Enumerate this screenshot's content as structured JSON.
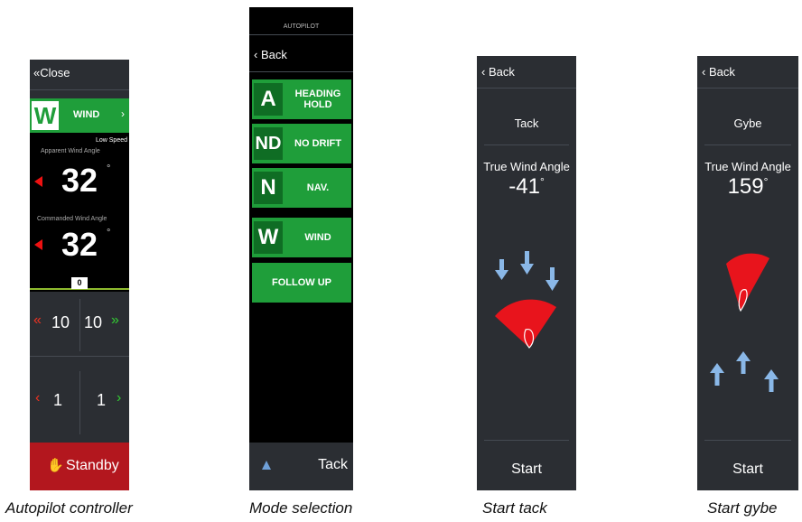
{
  "panel1": {
    "close_label": "Close",
    "mode_letter": "W",
    "mode_label": "WIND",
    "speed_mode": "Low Speed",
    "apparent_label": "Apparent Wind Angle",
    "apparent_value": "32",
    "commanded_label": "Commanded Wind Angle",
    "commanded_value": "32",
    "degree": "°",
    "rudder_value": "0",
    "port_10": "10",
    "stbd_10": "10",
    "port_1": "1",
    "stbd_1": "1",
    "standby_label": "Standby"
  },
  "panel2": {
    "title": "AUTOPILOT",
    "back_label": "Back",
    "modes": [
      {
        "letter": "A",
        "label": "HEADING HOLD"
      },
      {
        "letter": "ND",
        "label": "NO DRIFT"
      },
      {
        "letter": "N",
        "label": "NAV."
      },
      {
        "letter": "W",
        "label": "WIND"
      }
    ],
    "follow_up_label": "FOLLOW UP",
    "tack_label": "Tack"
  },
  "panel3": {
    "back_label": "Back",
    "title": "Tack",
    "twa_label": "True Wind Angle",
    "twa_value": "-41",
    "degree": "°",
    "start_label": "Start"
  },
  "panel4": {
    "back_label": "Back",
    "title": "Gybe",
    "twa_label": "True Wind Angle",
    "twa_value": "159",
    "degree": "°",
    "start_label": "Start"
  },
  "captions": {
    "c1": "Autopilot controller",
    "c2": "Mode selection",
    "c3": "Start tack",
    "c4": "Start gybe"
  },
  "colors": {
    "panel_bg": "#2b2e33",
    "mode_green": "#1f9e3a",
    "standby_red": "#b3171e",
    "wind_arrow_blue": "#8ab8e8",
    "sector_red": "#e8141c"
  }
}
